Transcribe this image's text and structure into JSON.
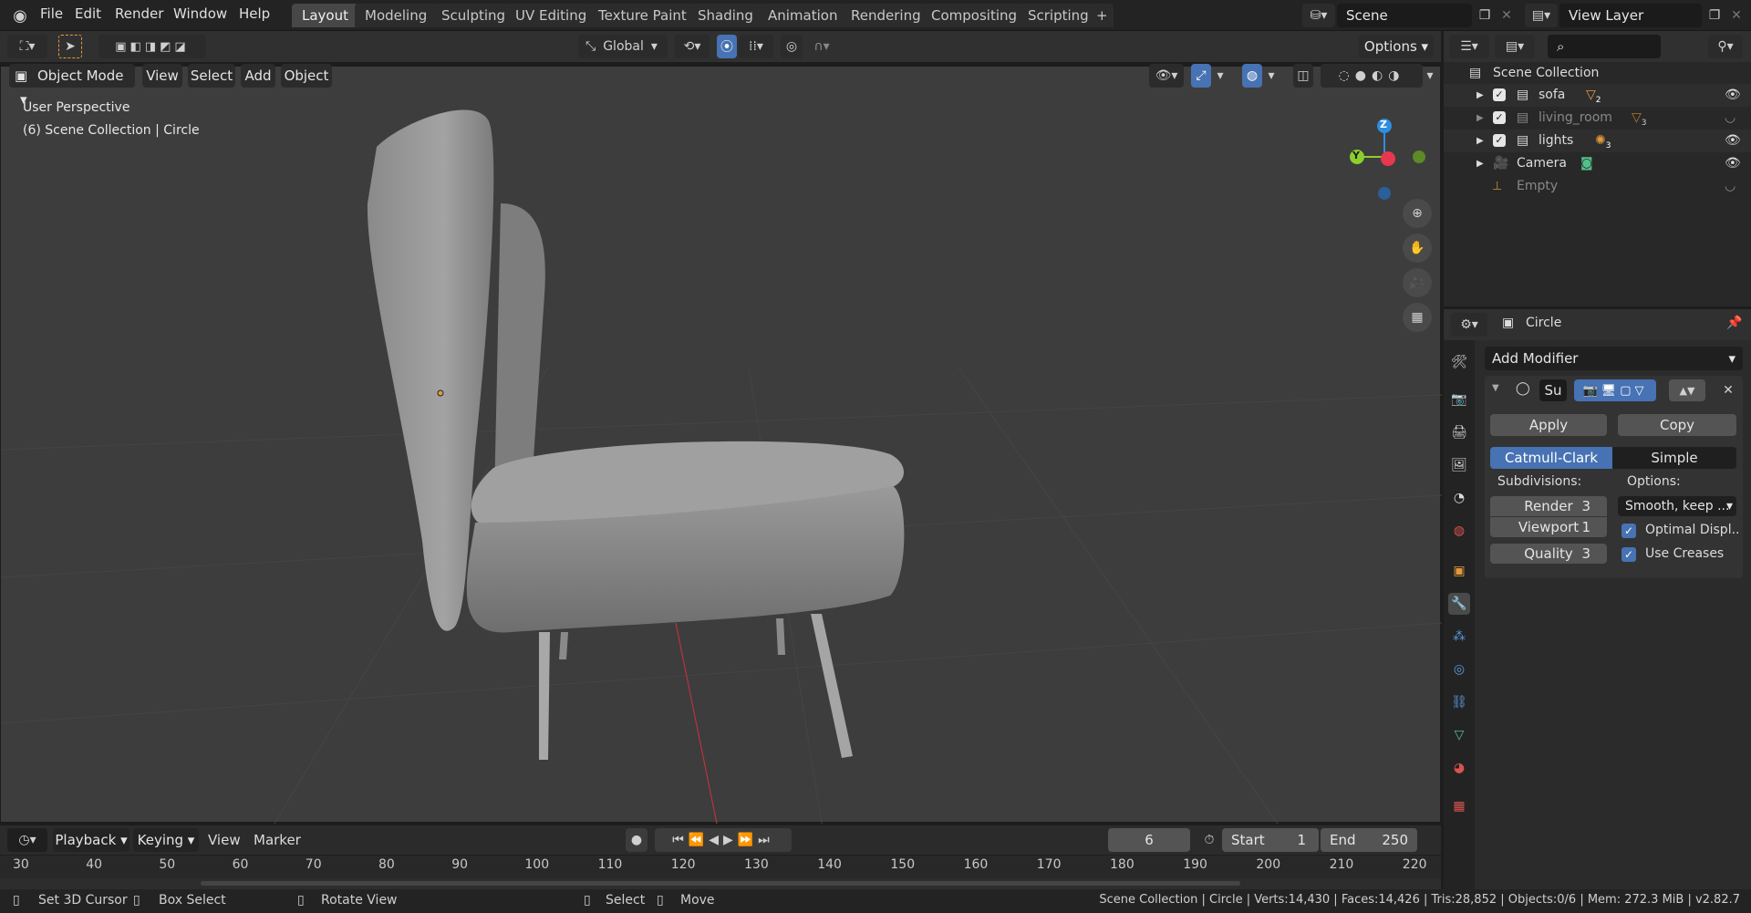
{
  "menu": [
    "File",
    "Edit",
    "Render",
    "Window",
    "Help"
  ],
  "workspaces": [
    "Layout",
    "Modeling",
    "Sculpting",
    "UV Editing",
    "Texture Paint",
    "Shading",
    "Animation",
    "Rendering",
    "Compositing",
    "Scripting"
  ],
  "active_workspace": "Layout",
  "scene_name": "Scene",
  "view_layer": "View Layer",
  "toolbar": {
    "orientation": "Global",
    "options": "Options"
  },
  "viewport_header": {
    "mode": "Object Mode",
    "menus": [
      "View",
      "Select",
      "Add",
      "Object"
    ]
  },
  "viewport_overlay": {
    "line1": "User Perspective",
    "line2": "(6) Scene Collection | Circle"
  },
  "gizmo": {
    "z": "Z",
    "y": "Y"
  },
  "outliner": {
    "root": "Scene Collection",
    "items": [
      {
        "label": "sofa",
        "badge": "2",
        "dim": false
      },
      {
        "label": "living_room",
        "badge": "3",
        "dim": true
      },
      {
        "label": "lights",
        "badge": "3",
        "dim": false
      },
      {
        "label": "Camera",
        "badge": "",
        "dim": false
      },
      {
        "label": "Empty",
        "badge": "",
        "dim": true
      }
    ]
  },
  "properties": {
    "object_name": "Circle",
    "add_modifier": "Add Modifier",
    "modifier_short": "Su",
    "apply": "Apply",
    "copy": "Copy",
    "catmull": "Catmull-Clark",
    "simple": "Simple",
    "subdivisions_label": "Subdivisions:",
    "options_label": "Options:",
    "render_label": "Render",
    "render_value": "3",
    "viewport_label": "Viewport",
    "viewport_value": "1",
    "quality_label": "Quality",
    "quality_value": "3",
    "uv_smooth": "Smooth, keep ...",
    "optimal_display": "Optimal Displ..",
    "use_creases": "Use Creases"
  },
  "timeline": {
    "menus": [
      "Playback",
      "Keying",
      "View",
      "Marker"
    ],
    "current_frame": "6",
    "start_label": "Start",
    "start_value": "1",
    "end_label": "End",
    "end_value": "250",
    "ticks": [
      "30",
      "40",
      "50",
      "60",
      "70",
      "80",
      "90",
      "100",
      "110",
      "120",
      "130",
      "140",
      "150",
      "160",
      "170",
      "180",
      "190",
      "200",
      "210",
      "220"
    ]
  },
  "statusbar": {
    "set_cursor": "Set 3D Cursor",
    "box_select": "Box Select",
    "rotate_view": "Rotate View",
    "select": "Select",
    "move": "Move",
    "stats": "Scene Collection | Circle | Verts:14,430 | Faces:14,426 | Tris:28,852 | Objects:0/6 | Mem: 272.3 MiB | v2.82.7"
  },
  "colors": {
    "accent": "#4772b3",
    "axis_x": "#e8384f",
    "axis_y": "#8ccf2b",
    "axis_z": "#2e8ee0",
    "orange": "#e29a3b"
  }
}
